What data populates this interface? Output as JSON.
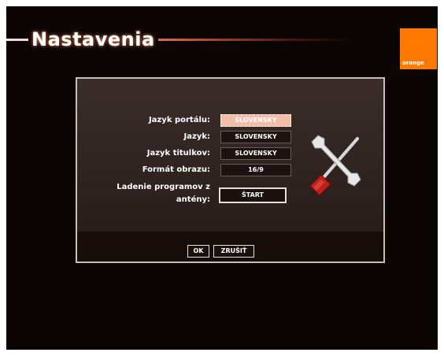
{
  "header": {
    "title": "Nastavenia",
    "logo_text": "orange"
  },
  "colors": {
    "brand_orange": "#ff7900",
    "background": "#0c0504",
    "active_field": "#f2bea8"
  },
  "form": {
    "rows": [
      {
        "label": "Jazyk portálu:",
        "value": "SLOVENSKY",
        "active": true
      },
      {
        "label": "Jazyk:",
        "value": "SLOVENSKY",
        "active": false
      },
      {
        "label": "Jazyk titulkov:",
        "value": "SLOVENSKY",
        "active": false
      },
      {
        "label": "Formát obrazu:",
        "value": "16/9",
        "active": false
      }
    ],
    "tuning_label_line1": "Ladenie programov z",
    "tuning_label_line2": "antény:",
    "start_label": "ŠTART"
  },
  "footer": {
    "ok_label": "OK",
    "back_label": "ZRUŠIŤ"
  },
  "icons": {
    "settings": "wrench-screwdriver-icon"
  }
}
